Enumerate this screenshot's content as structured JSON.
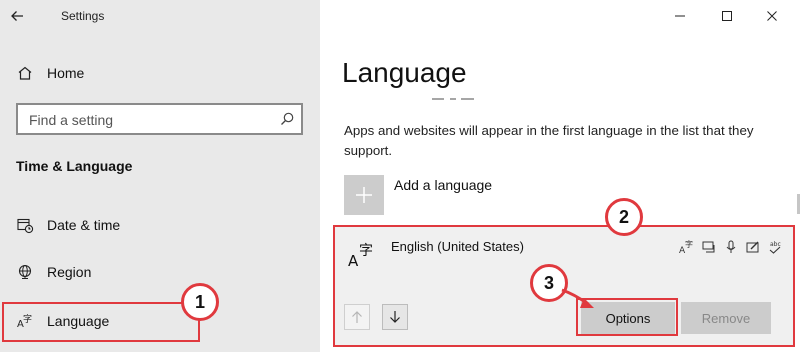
{
  "window": {
    "title": "Settings"
  },
  "sidebar": {
    "home_label": "Home",
    "search_placeholder": "Find a setting",
    "section_heading": "Time & Language",
    "items": [
      {
        "label": "Date & time",
        "icon": "calendar-clock-icon"
      },
      {
        "label": "Region",
        "icon": "globe-icon"
      },
      {
        "label": "Language",
        "icon": "language-icon"
      }
    ]
  },
  "main": {
    "page_title": "Language",
    "description": "Apps and websites will appear in the first language in the list that they support.",
    "add_language_label": "Add a language",
    "language_entry": {
      "name": "English (United States)",
      "features": [
        "display-language-icon",
        "speech-icon",
        "microphone-icon",
        "handwriting-icon",
        "spellcheck-icon"
      ],
      "options_label": "Options",
      "remove_label": "Remove"
    }
  },
  "annotations": {
    "badge_1": "1",
    "badge_2": "2",
    "badge_3": "3",
    "color": "#e0393e"
  }
}
